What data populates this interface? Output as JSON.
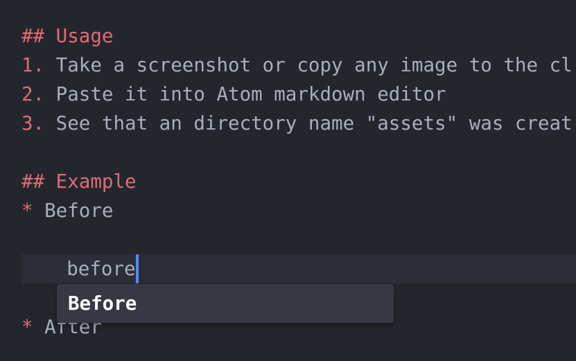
{
  "editor": {
    "lines": [
      {
        "marker": "## ",
        "text": "Usage",
        "heading": true
      },
      {
        "marker": "1. ",
        "text": "Take a screenshot or copy any image to the cl"
      },
      {
        "marker": "2. ",
        "text": "Paste it into Atom markdown editor"
      },
      {
        "marker": "3. ",
        "text": "See that an directory name \"assets\" was creat"
      },
      {
        "marker": "",
        "text": ""
      },
      {
        "marker": "## ",
        "text": "Example",
        "heading": true
      },
      {
        "marker": "* ",
        "text": "Before"
      },
      {
        "marker": "",
        "text": ""
      },
      {
        "marker": "",
        "text": "    before"
      },
      {
        "marker": "",
        "text": ""
      },
      {
        "marker": "* ",
        "text": "After"
      }
    ]
  },
  "autocomplete": {
    "suggestion": "Before"
  },
  "colors": {
    "background": "#24262d",
    "text": "#a6afbd",
    "markup": "#e06c75",
    "caret": "#528bff",
    "popup": "#363944"
  }
}
